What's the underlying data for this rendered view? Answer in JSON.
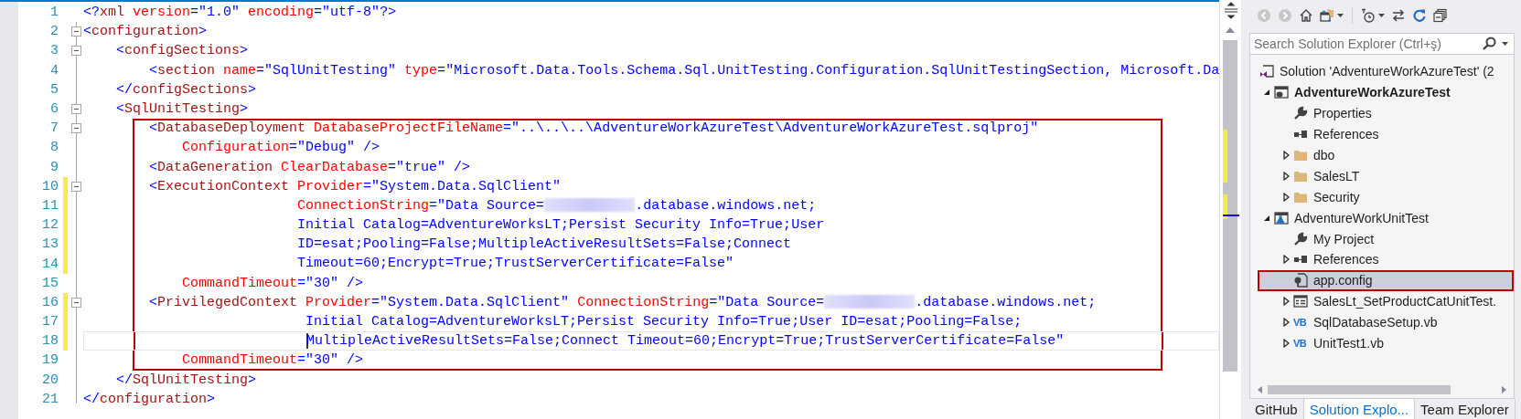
{
  "editor": {
    "lines": [
      {
        "number": "1",
        "changed": false,
        "foldable": false,
        "current": false,
        "boxed": false,
        "tokens": [
          {
            "kind": "delim",
            "text": "<?"
          },
          {
            "kind": "tag",
            "text": "xml"
          },
          {
            "kind": "attr",
            "text": " version"
          },
          {
            "kind": "delim",
            "text": "="
          },
          {
            "kind": "value",
            "text": "\"1.0\""
          },
          {
            "kind": "attr",
            "text": " encoding"
          },
          {
            "kind": "delim",
            "text": "="
          },
          {
            "kind": "value",
            "text": "\"utf-8\""
          },
          {
            "kind": "delim",
            "text": "?>"
          }
        ]
      },
      {
        "number": "2",
        "changed": false,
        "foldable": true,
        "current": false,
        "boxed": false,
        "tokens": [
          {
            "kind": "delim",
            "text": "<"
          },
          {
            "kind": "tag",
            "text": "configuration"
          },
          {
            "kind": "delim",
            "text": ">"
          }
        ]
      },
      {
        "number": "3",
        "changed": false,
        "foldable": true,
        "current": false,
        "boxed": false,
        "tokens": [
          {
            "kind": "delim",
            "text": "    <"
          },
          {
            "kind": "tag",
            "text": "configSections"
          },
          {
            "kind": "delim",
            "text": ">"
          }
        ]
      },
      {
        "number": "4",
        "changed": false,
        "foldable": false,
        "current": false,
        "boxed": false,
        "tokens": [
          {
            "kind": "delim",
            "text": "        <"
          },
          {
            "kind": "tag",
            "text": "section"
          },
          {
            "kind": "attr",
            "text": " name"
          },
          {
            "kind": "delim",
            "text": "="
          },
          {
            "kind": "value",
            "text": "\"SqlUnitTesting\""
          },
          {
            "kind": "attr",
            "text": " type"
          },
          {
            "kind": "delim",
            "text": "="
          },
          {
            "kind": "value",
            "text": "\"Microsoft.Data.Tools.Schema.Sql.UnitTesting.Configuration.SqlUnitTestingSection, Microsoft.Da"
          }
        ]
      },
      {
        "number": "5",
        "changed": false,
        "foldable": false,
        "current": false,
        "boxed": false,
        "tokens": [
          {
            "kind": "delim",
            "text": "    </"
          },
          {
            "kind": "tag",
            "text": "configSections"
          },
          {
            "kind": "delim",
            "text": ">"
          }
        ]
      },
      {
        "number": "6",
        "changed": false,
        "foldable": true,
        "current": false,
        "boxed": false,
        "tokens": [
          {
            "kind": "delim",
            "text": "    <"
          },
          {
            "kind": "tag",
            "text": "SqlUnitTesting"
          },
          {
            "kind": "delim",
            "text": ">"
          }
        ]
      },
      {
        "number": "7",
        "changed": false,
        "foldable": true,
        "current": false,
        "boxed": true,
        "tokens": [
          {
            "kind": "delim",
            "text": "        <"
          },
          {
            "kind": "tag",
            "text": "DatabaseDeployment"
          },
          {
            "kind": "attr",
            "text": " DatabaseProjectFileName"
          },
          {
            "kind": "delim",
            "text": "="
          },
          {
            "kind": "value",
            "text": "\"..\\..\\..\\AdventureWorkAzureTest\\AdventureWorkAzureTest.sqlproj\""
          }
        ]
      },
      {
        "number": "8",
        "changed": false,
        "foldable": false,
        "current": false,
        "boxed": true,
        "tokens": [
          {
            "kind": "attr",
            "text": "            Configuration"
          },
          {
            "kind": "delim",
            "text": "="
          },
          {
            "kind": "value",
            "text": "\"Debug\""
          },
          {
            "kind": "delim",
            "text": " />"
          }
        ]
      },
      {
        "number": "9",
        "changed": false,
        "foldable": false,
        "current": false,
        "boxed": true,
        "tokens": [
          {
            "kind": "delim",
            "text": "        <"
          },
          {
            "kind": "tag",
            "text": "DataGeneration"
          },
          {
            "kind": "attr",
            "text": " ClearDatabase"
          },
          {
            "kind": "delim",
            "text": "="
          },
          {
            "kind": "value",
            "text": "\"true\""
          },
          {
            "kind": "delim",
            "text": " />"
          }
        ]
      },
      {
        "number": "10",
        "changed": true,
        "foldable": true,
        "current": false,
        "boxed": true,
        "tokens": [
          {
            "kind": "delim",
            "text": "        <"
          },
          {
            "kind": "tag",
            "text": "ExecutionContext"
          },
          {
            "kind": "attr",
            "text": " Provider"
          },
          {
            "kind": "delim",
            "text": "="
          },
          {
            "kind": "value",
            "text": "\"System.Data.SqlClient\""
          }
        ]
      },
      {
        "number": "11",
        "changed": true,
        "foldable": false,
        "current": false,
        "boxed": true,
        "tokens": [
          {
            "kind": "attr",
            "text": "                          ConnectionString"
          },
          {
            "kind": "delim",
            "text": "="
          },
          {
            "kind": "value",
            "text": "\"Data Source="
          },
          {
            "kind": "redacted"
          },
          {
            "kind": "value",
            "text": ".database.windows.net;"
          }
        ]
      },
      {
        "number": "12",
        "changed": true,
        "foldable": false,
        "current": false,
        "boxed": true,
        "tokens": [
          {
            "kind": "value",
            "text": "                          Initial Catalog=AdventureWorksLT;Persist Security Info=True;User"
          }
        ]
      },
      {
        "number": "13",
        "changed": true,
        "foldable": false,
        "current": false,
        "boxed": true,
        "tokens": [
          {
            "kind": "value",
            "text": "                          ID=esat;Pooling=False;MultipleActiveResultSets=False;Connect"
          }
        ]
      },
      {
        "number": "14",
        "changed": true,
        "foldable": false,
        "current": false,
        "boxed": true,
        "tokens": [
          {
            "kind": "value",
            "text": "                          Timeout=60;Encrypt=True;TrustServerCertificate=False\""
          }
        ]
      },
      {
        "number": "15",
        "changed": false,
        "foldable": false,
        "current": false,
        "boxed": true,
        "tokens": [
          {
            "kind": "attr",
            "text": "            CommandTimeout"
          },
          {
            "kind": "delim",
            "text": "="
          },
          {
            "kind": "value",
            "text": "\"30\""
          },
          {
            "kind": "delim",
            "text": " />"
          }
        ]
      },
      {
        "number": "16",
        "changed": true,
        "foldable": true,
        "current": false,
        "boxed": true,
        "tokens": [
          {
            "kind": "delim",
            "text": "        <"
          },
          {
            "kind": "tag",
            "text": "PrivilegedContext"
          },
          {
            "kind": "attr",
            "text": " Provider"
          },
          {
            "kind": "delim",
            "text": "="
          },
          {
            "kind": "value",
            "text": "\"System.Data.SqlClient\""
          },
          {
            "kind": "attr",
            "text": " ConnectionString"
          },
          {
            "kind": "delim",
            "text": "="
          },
          {
            "kind": "value",
            "text": "\"Data Source="
          },
          {
            "kind": "redacted"
          },
          {
            "kind": "value",
            "text": ".database.windows.net;"
          }
        ]
      },
      {
        "number": "17",
        "changed": true,
        "foldable": false,
        "current": false,
        "boxed": true,
        "tokens": [
          {
            "kind": "value",
            "text": "                           Initial Catalog=AdventureWorksLT;Persist Security Info=True;User ID=esat;Pooling=False;"
          }
        ]
      },
      {
        "number": "18",
        "changed": true,
        "foldable": false,
        "current": true,
        "boxed": true,
        "tokens": [
          {
            "kind": "value",
            "text": "                           MultipleActiveResultSets=False;Connect Timeout=60;Encrypt=True;TrustServerCertificate=False\""
          }
        ]
      },
      {
        "number": "19",
        "changed": false,
        "foldable": false,
        "current": false,
        "boxed": true,
        "tokens": [
          {
            "kind": "attr",
            "text": "            CommandTimeout"
          },
          {
            "kind": "delim",
            "text": "="
          },
          {
            "kind": "value",
            "text": "\"30\""
          },
          {
            "kind": "delim",
            "text": " />"
          }
        ]
      },
      {
        "number": "20",
        "changed": false,
        "foldable": false,
        "current": false,
        "boxed": false,
        "tokens": [
          {
            "kind": "delim",
            "text": "    </"
          },
          {
            "kind": "tag",
            "text": "SqlUnitTesting"
          },
          {
            "kind": "delim",
            "text": ">"
          }
        ]
      },
      {
        "number": "21",
        "changed": false,
        "foldable": false,
        "current": false,
        "boxed": false,
        "tokens": [
          {
            "kind": "delim",
            "text": "</"
          },
          {
            "kind": "tag",
            "text": "configuration"
          },
          {
            "kind": "delim",
            "text": ">"
          }
        ]
      }
    ]
  },
  "solution_explorer": {
    "toolbar": [
      {
        "kind": "back",
        "disabled": true
      },
      {
        "kind": "forward",
        "disabled": true
      },
      {
        "kind": "home",
        "disabled": false
      },
      {
        "kind": "sync",
        "disabled": false
      },
      {
        "kind": "history",
        "disabled": false
      },
      {
        "kind": "swap",
        "disabled": false
      },
      {
        "kind": "refresh",
        "disabled": false
      },
      {
        "kind": "collapse",
        "disabled": false
      }
    ],
    "search": {
      "placeholder": "Search Solution Explorer (Ctrl+ş)"
    },
    "tree": [
      {
        "label": "Solution 'AdventureWorkAzureTest' (2",
        "kind": "solution",
        "selected": false,
        "boxed": false,
        "children": [
          {
            "label": "AdventureWorkAzureTest",
            "kind": "dbproject",
            "startup": true,
            "expanded": true,
            "selected": false,
            "boxed": false,
            "children": [
              {
                "label": "Properties",
                "kind": "wrench",
                "selected": false,
                "boxed": false
              },
              {
                "label": "References",
                "kind": "references",
                "selected": false,
                "boxed": false
              },
              {
                "label": "dbo",
                "kind": "folder",
                "expanded": false,
                "selected": false,
                "boxed": false
              },
              {
                "label": "SalesLT",
                "kind": "folder",
                "expanded": false,
                "selected": false,
                "boxed": false
              },
              {
                "label": "Security",
                "kind": "folder",
                "expanded": false,
                "selected": false,
                "boxed": false
              }
            ]
          },
          {
            "label": "AdventureWorkUnitTest",
            "kind": "testproject",
            "startup": false,
            "expanded": true,
            "selected": false,
            "boxed": false,
            "children": [
              {
                "label": "My Project",
                "kind": "wrench",
                "selected": false,
                "boxed": false
              },
              {
                "label": "References",
                "kind": "references",
                "expanded": false,
                "selected": false,
                "boxed": false
              },
              {
                "label": "app.config",
                "kind": "config",
                "selected": true,
                "boxed": true
              },
              {
                "label": "SalesLt_SetProductCatUnitTest.",
                "kind": "testfile",
                "expanded": false,
                "selected": false,
                "boxed": false
              },
              {
                "label": "SqlDatabaseSetup.vb",
                "kind": "vbfile",
                "icon_label": "VB",
                "expanded": false,
                "selected": false,
                "boxed": false
              },
              {
                "label": "UnitTest1.vb",
                "kind": "vbfile",
                "icon_label": "VB",
                "expanded": false,
                "selected": false,
                "boxed": false
              }
            ]
          }
        ]
      }
    ],
    "tabs": [
      {
        "label": "GitHub",
        "selected": false
      },
      {
        "label": "Solution Explo...",
        "selected": true
      },
      {
        "label": "Team Explorer",
        "selected": false
      }
    ]
  }
}
